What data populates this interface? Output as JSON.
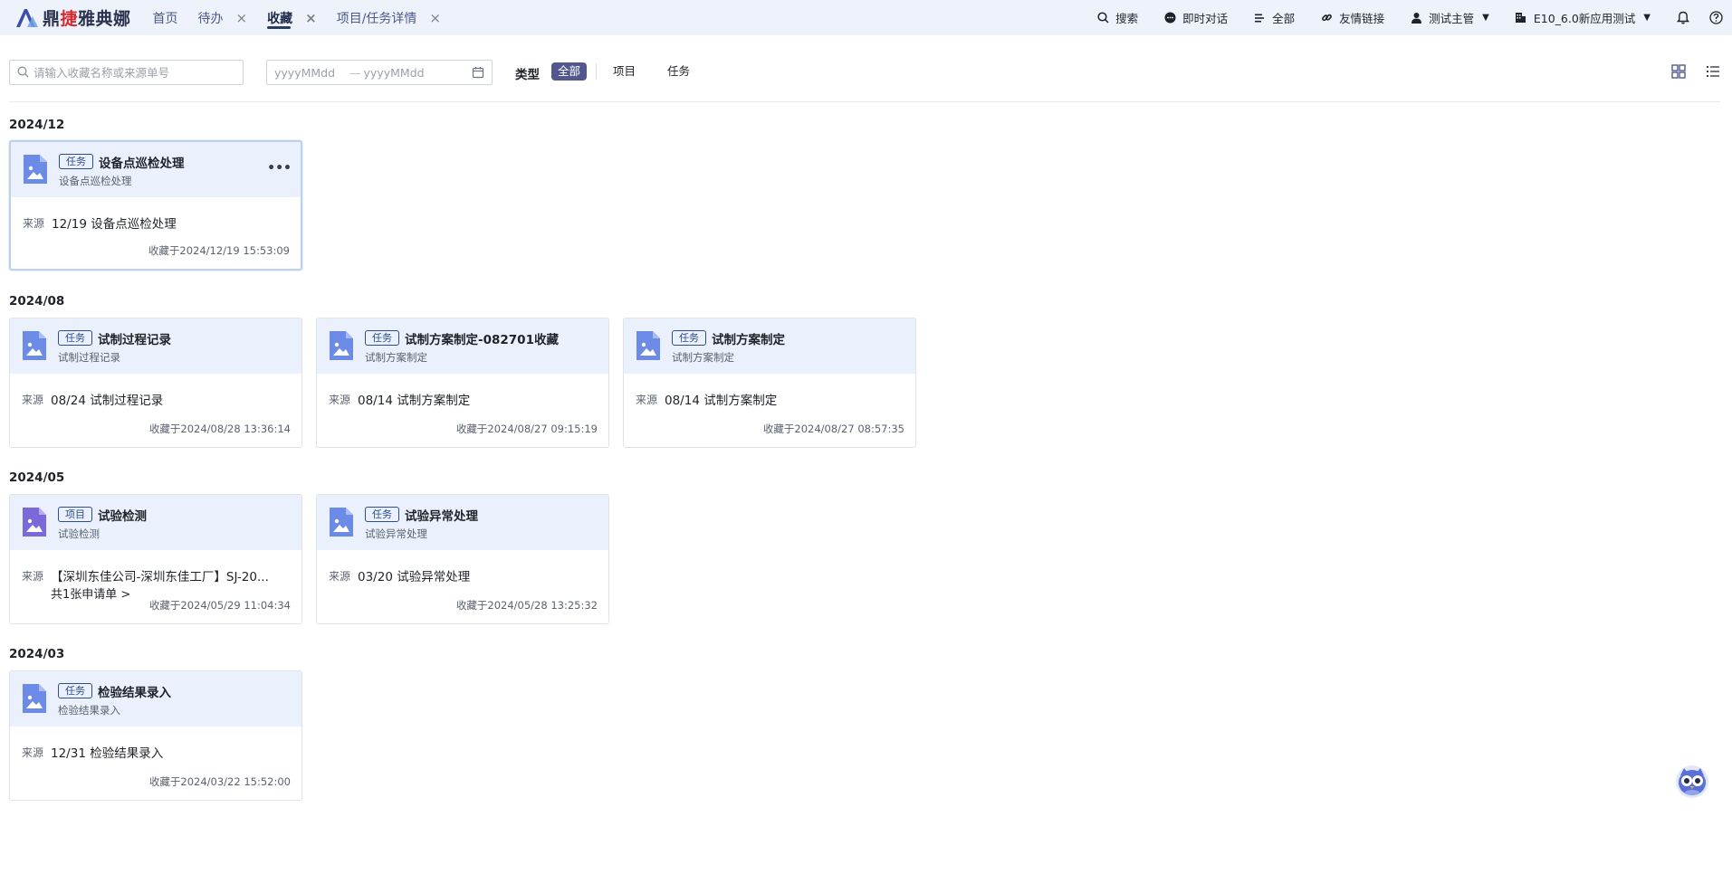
{
  "header": {
    "logo_text_1": "鼎",
    "logo_text_2": "捷",
    "logo_text_3": "雅典娜",
    "tabs": [
      {
        "label": "首页",
        "closable": false,
        "active": false
      },
      {
        "label": "待办",
        "closable": true,
        "active": false
      },
      {
        "label": "收藏",
        "closable": true,
        "active": true
      },
      {
        "label": "项目/任务详情",
        "closable": true,
        "active": false
      }
    ],
    "close_glyph": "×",
    "nav": {
      "search": "搜索",
      "chat": "即时对话",
      "all": "全部",
      "links": "友情链接",
      "user": "测试主管",
      "tenant": "E10_6.0新应用测试"
    },
    "caret": "▼"
  },
  "filter": {
    "search_placeholder": "请输入收藏名称或来源单号",
    "date_start_placeholder": "yyyyMMdd",
    "date_sep": "—",
    "date_end_placeholder": "yyyyMMdd",
    "type_label": "类型",
    "type_options": [
      "全部",
      "项目",
      "任务"
    ]
  },
  "common": {
    "source_label": "来源",
    "more_glyph": "•••"
  },
  "groups": [
    {
      "title": "2024/12",
      "cards": [
        {
          "tag": "任务",
          "title": "设备点巡检处理",
          "subtitle": "设备点巡检处理",
          "source": "12/19 设备点巡检处理",
          "time": "收藏于2024/12/19 15:53:09"
        }
      ]
    },
    {
      "title": "2024/08",
      "cards": [
        {
          "tag": "任务",
          "title": "试制过程记录",
          "subtitle": "试制过程记录",
          "source": "08/24 试制过程记录",
          "time": "收藏于2024/08/28 13:36:14"
        },
        {
          "tag": "任务",
          "title": "试制方案制定-082701收藏",
          "subtitle": "试制方案制定",
          "source": "08/14 试制方案制定",
          "time": "收藏于2024/08/27 09:15:19"
        },
        {
          "tag": "任务",
          "title": "试制方案制定",
          "subtitle": "试制方案制定",
          "source": "08/14 试制方案制定",
          "time": "收藏于2024/08/27 08:57:35"
        }
      ]
    },
    {
      "title": "2024/05",
      "cards": [
        {
          "tag": "项目",
          "title": "试验检测",
          "subtitle": "试验检测",
          "source": "【深圳东佳公司-深圳东佳工厂】SJ-20...",
          "extra": "共1张申请单 >",
          "time": "收藏于2024/05/29 11:04:34"
        },
        {
          "tag": "任务",
          "title": "试验异常处理",
          "subtitle": "试验异常处理",
          "source": "03/20 试验异常处理",
          "time": "收藏于2024/05/28 13:25:32"
        }
      ]
    },
    {
      "title": "2024/03",
      "cards": [
        {
          "tag": "任务",
          "title": "检验结果录入",
          "subtitle": "检验结果录入",
          "source": "12/31 检验结果录入",
          "time": "收藏于2024/03/22 15:52:00"
        }
      ]
    }
  ],
  "colors": {
    "topbar_bg": "#eef2fa",
    "card_head_bg": "#eaf1fc",
    "task_icon": "#6b8be6",
    "project_icon": "#7b68d9",
    "active_type_bg": "#52588f"
  },
  "icons": {
    "search": "search-icon",
    "chat": "chat-bubble-icon",
    "all": "list-icon",
    "links": "link-icon",
    "user": "user-icon",
    "tenant": "building-icon",
    "bell": "bell-icon",
    "help": "help-circle-icon",
    "calendar": "calendar-icon",
    "grid_view": "grid-view-icon",
    "list_view": "list-view-icon",
    "card_file": "image-file-icon",
    "assistant": "owl-assistant-icon"
  }
}
